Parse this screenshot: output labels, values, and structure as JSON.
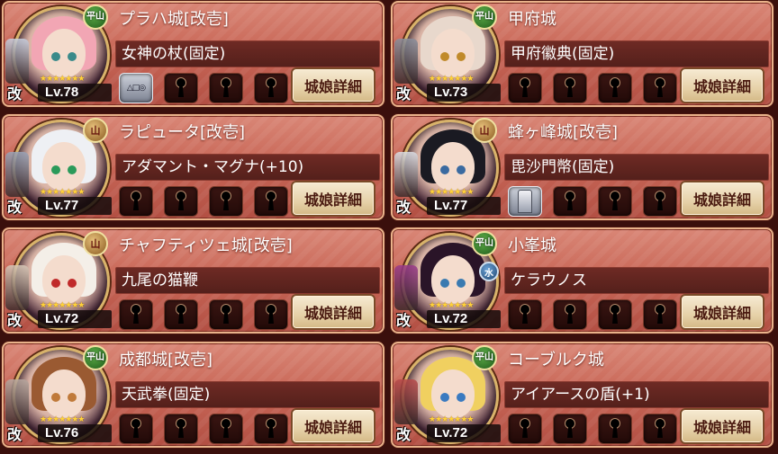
{
  "detail_label": "城娘詳細",
  "kai_label": "改",
  "stars": "★★★★★★★",
  "cards": [
    {
      "name": "プラハ城[改壱]",
      "weapon": "女神の杖(固定)",
      "level": "Lv.78",
      "terrain": "平山",
      "extra_badge": "",
      "slot_filled": "△□◎",
      "hair": "#f2a6b4",
      "eye": "#3a8a8a",
      "deco": "#c8d0e0"
    },
    {
      "name": "甲府城",
      "weapon": "甲府徽典(固定)",
      "level": "Lv.73",
      "terrain": "平山",
      "extra_badge": "",
      "slot_filled": "",
      "hair": "#e8d8cc",
      "eye": "#c08a2a",
      "deco": "#8a8f9c"
    },
    {
      "name": "ラピュータ[改壱]",
      "weapon": "アダマント・マグナ(+10)",
      "level": "Lv.77",
      "terrain": "山",
      "extra_badge": "",
      "slot_filled": "",
      "hair": "#eef0f4",
      "eye": "#2a9a5a",
      "deco": "#9aa4b8"
    },
    {
      "name": "蜂ヶ峰城[改壱]",
      "weapon": "毘沙門幣(固定)",
      "level": "Lv.77",
      "terrain": "山",
      "extra_badge": "",
      "slot_filled": "pillar",
      "hair": "#1a1a22",
      "eye": "#3a6aa0",
      "deco": "#dcdfe6"
    },
    {
      "name": "チャフティツェ城[改壱]",
      "weapon": "九尾の猫鞭",
      "level": "Lv.72",
      "terrain": "山",
      "extra_badge": "",
      "slot_filled": "",
      "hair": "#f4efe8",
      "eye": "#c02a2a",
      "deco": "#d8c8b8"
    },
    {
      "name": "小峯城",
      "weapon": "ケラウノス",
      "level": "Lv.72",
      "terrain": "平山",
      "extra_badge": "水",
      "slot_filled": "",
      "hair": "#2a1428",
      "eye": "#3a7ab0",
      "deco": "#9a3a8a"
    },
    {
      "name": "成都城[改壱]",
      "weapon": "天武拳(固定)",
      "level": "Lv.76",
      "terrain": "平山",
      "extra_badge": "",
      "slot_filled": "",
      "hair": "#9a5a32",
      "eye": "#c07a3a",
      "deco": "#b8a8a0"
    },
    {
      "name": "コーブルク城",
      "weapon": "アイアースの盾(+1)",
      "level": "Lv.72",
      "terrain": "平山",
      "extra_badge": "",
      "slot_filled": "",
      "hair": "#f0d060",
      "eye": "#3a7ac0",
      "deco": "#b84a4a"
    }
  ]
}
